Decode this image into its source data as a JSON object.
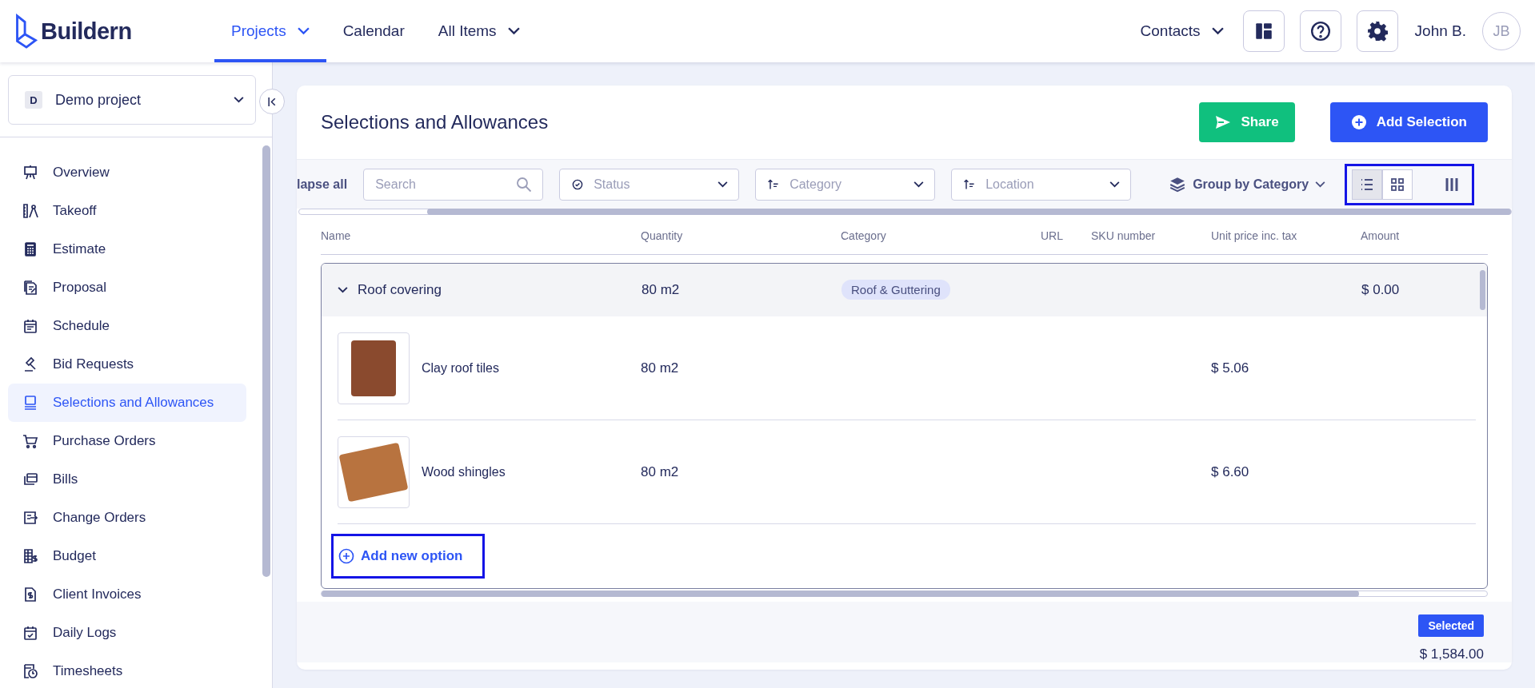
{
  "header": {
    "logo": "Buildern",
    "nav": [
      {
        "label": "Projects",
        "dropdown": true,
        "selected": true
      },
      {
        "label": "Calendar",
        "dropdown": false,
        "selected": false
      },
      {
        "label": "All Items",
        "dropdown": true,
        "selected": false
      }
    ],
    "contacts": "Contacts",
    "user": {
      "name": "John B.",
      "initials": "JB"
    }
  },
  "sidebar": {
    "project": {
      "badge": "D",
      "name": "Demo project"
    },
    "items": [
      {
        "label": "Overview",
        "selected": false
      },
      {
        "label": "Takeoff",
        "selected": false
      },
      {
        "label": "Estimate",
        "selected": false
      },
      {
        "label": "Proposal",
        "selected": false
      },
      {
        "label": "Schedule",
        "selected": false
      },
      {
        "label": "Bid Requests",
        "selected": false
      },
      {
        "label": "Selections and Allowances",
        "selected": true
      },
      {
        "label": "Purchase Orders",
        "selected": false
      },
      {
        "label": "Bills",
        "selected": false
      },
      {
        "label": "Change Orders",
        "selected": false
      },
      {
        "label": "Budget",
        "selected": false
      },
      {
        "label": "Client Invoices",
        "selected": false
      },
      {
        "label": "Daily Logs",
        "selected": false
      },
      {
        "label": "Timesheets",
        "selected": false
      }
    ]
  },
  "page": {
    "title": "Selections and Allowances",
    "buttons": [
      {
        "label": "Share",
        "kind": "share"
      },
      {
        "label": "Add Selection",
        "kind": "add"
      }
    ]
  },
  "toolbar": {
    "collapse": "lapse all",
    "search": {
      "placeholder": "Search"
    },
    "filters": [
      {
        "placeholder": "Status",
        "kind": "status"
      },
      {
        "placeholder": "Category",
        "kind": "sort"
      },
      {
        "placeholder": "Location",
        "kind": "sort"
      }
    ],
    "group_by": "Group by Category",
    "views_highlighted": true,
    "views": [
      {
        "kind": "list",
        "selected": true
      },
      {
        "kind": "grid",
        "selected": false
      },
      {
        "kind": "columns",
        "selected": false
      }
    ]
  },
  "table": {
    "columns": [
      "Name",
      "Quantity",
      "Category",
      "URL",
      "SKU number",
      "Unit price inc. tax",
      "Amount"
    ],
    "groups": [
      {
        "name": "Roof covering",
        "expanded": true,
        "quantity": "80 m2",
        "category": "Roof & Guttering",
        "amount": "$ 0.00",
        "options": [
          {
            "name": "Clay roof tiles",
            "quantity": "80 m2",
            "unit_price": "$ 5.06"
          },
          {
            "name": "Wood shingles",
            "quantity": "80 m2",
            "unit_price": "$ 6.60"
          }
        ],
        "add_option": {
          "label": "Add new option",
          "highlighted": true
        }
      }
    ]
  },
  "footer": {
    "badge": "Selected",
    "total": "$ 1,584.00"
  }
}
